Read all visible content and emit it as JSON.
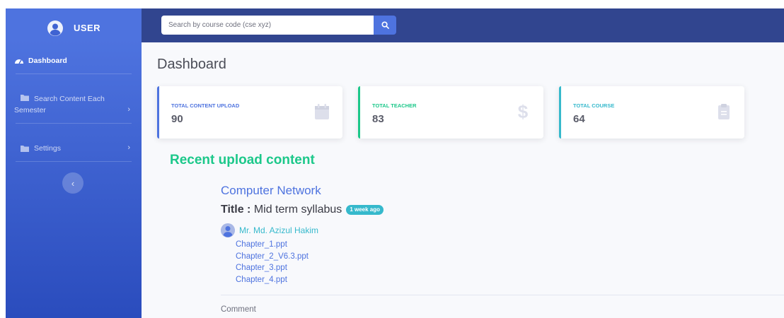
{
  "sidebar": {
    "brand_label": "USER",
    "items": [
      {
        "label": "Dashboard",
        "icon": "tachometer-icon",
        "active": true
      },
      {
        "label": "Search Content Each Semester",
        "icon": "folder-icon",
        "has_chevron": true
      },
      {
        "label": "Settings",
        "icon": "folder-icon",
        "has_chevron": true
      }
    ],
    "toggle_glyph": "‹"
  },
  "search": {
    "placeholder": "Search by course code (cse xyz)",
    "value": ""
  },
  "main": {
    "title": "Dashboard",
    "cards": [
      {
        "label": "TOTAL CONTENT UPLOAD",
        "value": "90",
        "icon": "calendar-icon",
        "color": "#4e73df"
      },
      {
        "label": "TOTAL TEACHER",
        "value": "83",
        "icon": "dollar-icon",
        "color": "#1cc88a"
      },
      {
        "label": "TOTAL COURSE",
        "value": "64",
        "icon": "clipboard-icon",
        "color": "#36b9cc"
      }
    ],
    "recent_heading": "Recent upload content",
    "upload": {
      "course": "Computer Network",
      "title_prefix": "Title :",
      "title": "Mid term syllabus",
      "time_badge": "1 week ago",
      "author": "Mr. Md. Azizul Hakim",
      "files": [
        "Chapter_1.ppt",
        "Chapter_2_V6.3.ppt",
        "Chapter_3.ppt",
        "Chapter_4.ppt"
      ],
      "comment_label": "Comment"
    }
  },
  "colors": {
    "primary": "#4e73df",
    "success": "#1cc88a",
    "info": "#36b9cc",
    "topbar": "#31458f"
  }
}
